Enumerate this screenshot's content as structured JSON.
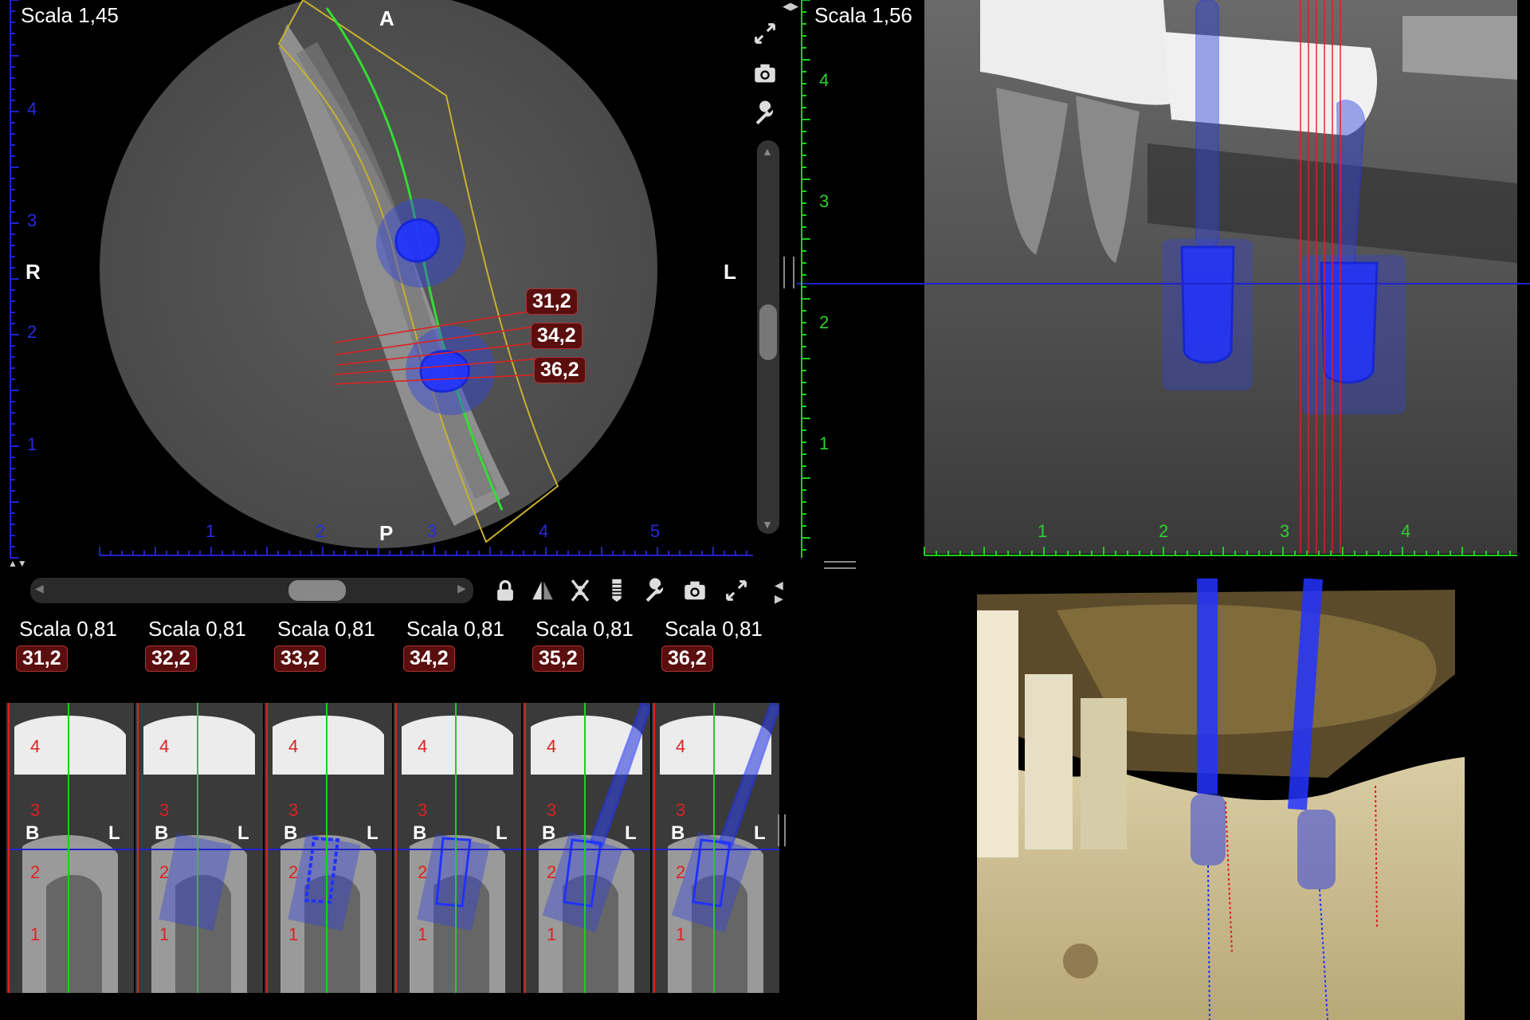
{
  "axial_view": {
    "scale_label": "Scala 1,45",
    "orient_top": "A",
    "orient_bottom": "P",
    "orient_left": "R",
    "orient_right": "L",
    "y_ticks": [
      "4",
      "3",
      "2",
      "1"
    ],
    "x_ticks": [
      "1",
      "2",
      "3",
      "4",
      "5"
    ],
    "section_badges": [
      "31,2",
      "34,2",
      "36,2"
    ]
  },
  "panoramic_view": {
    "scale_label": "Scala 1,56",
    "y_ticks": [
      "4",
      "3",
      "2",
      "1"
    ],
    "x_ticks": [
      "1",
      "2",
      "3",
      "4"
    ]
  },
  "toolbar_top": {
    "icons": [
      "expand-icon",
      "camera-icon",
      "wrench-icon"
    ]
  },
  "toolbar_bottom": {
    "icons": [
      "lock-icon",
      "mirror-icon",
      "implant-cut-icon",
      "implant-icon",
      "wrench-icon",
      "camera-icon",
      "expand-icon"
    ]
  },
  "cross_sections": [
    {
      "scale": "Scala 0,81",
      "badge": "31,2",
      "left": "B",
      "right": "L",
      "ticks": [
        "4",
        "3",
        "2",
        "1"
      ]
    },
    {
      "scale": "Scala 0,81",
      "badge": "32,2",
      "left": "B",
      "right": "L",
      "ticks": [
        "4",
        "3",
        "2",
        "1"
      ]
    },
    {
      "scale": "Scala 0,81",
      "badge": "33,2",
      "left": "B",
      "right": "L",
      "ticks": [
        "4",
        "3",
        "2",
        "1"
      ]
    },
    {
      "scale": "Scala 0,81",
      "badge": "34,2",
      "left": "B",
      "right": "L",
      "ticks": [
        "4",
        "3",
        "2",
        "1"
      ]
    },
    {
      "scale": "Scala 0,81",
      "badge": "35,2",
      "left": "B",
      "right": "L",
      "ticks": [
        "4",
        "3",
        "2",
        "1"
      ]
    },
    {
      "scale": "Scala 0,81",
      "badge": "36,2",
      "left": "B",
      "right": "L",
      "ticks": [
        "4",
        "3",
        "2",
        "1"
      ]
    }
  ],
  "colors": {
    "axial_ruler": "#2222cc",
    "pano_ruler": "#22cc22",
    "section_line": "#dd2222",
    "implant": "#2233ff",
    "nerve_path": "#33dd33",
    "arch_outline": "#c8b030",
    "badge_bg": "#5a0e0e",
    "bone_3d": "#c9b98a"
  }
}
